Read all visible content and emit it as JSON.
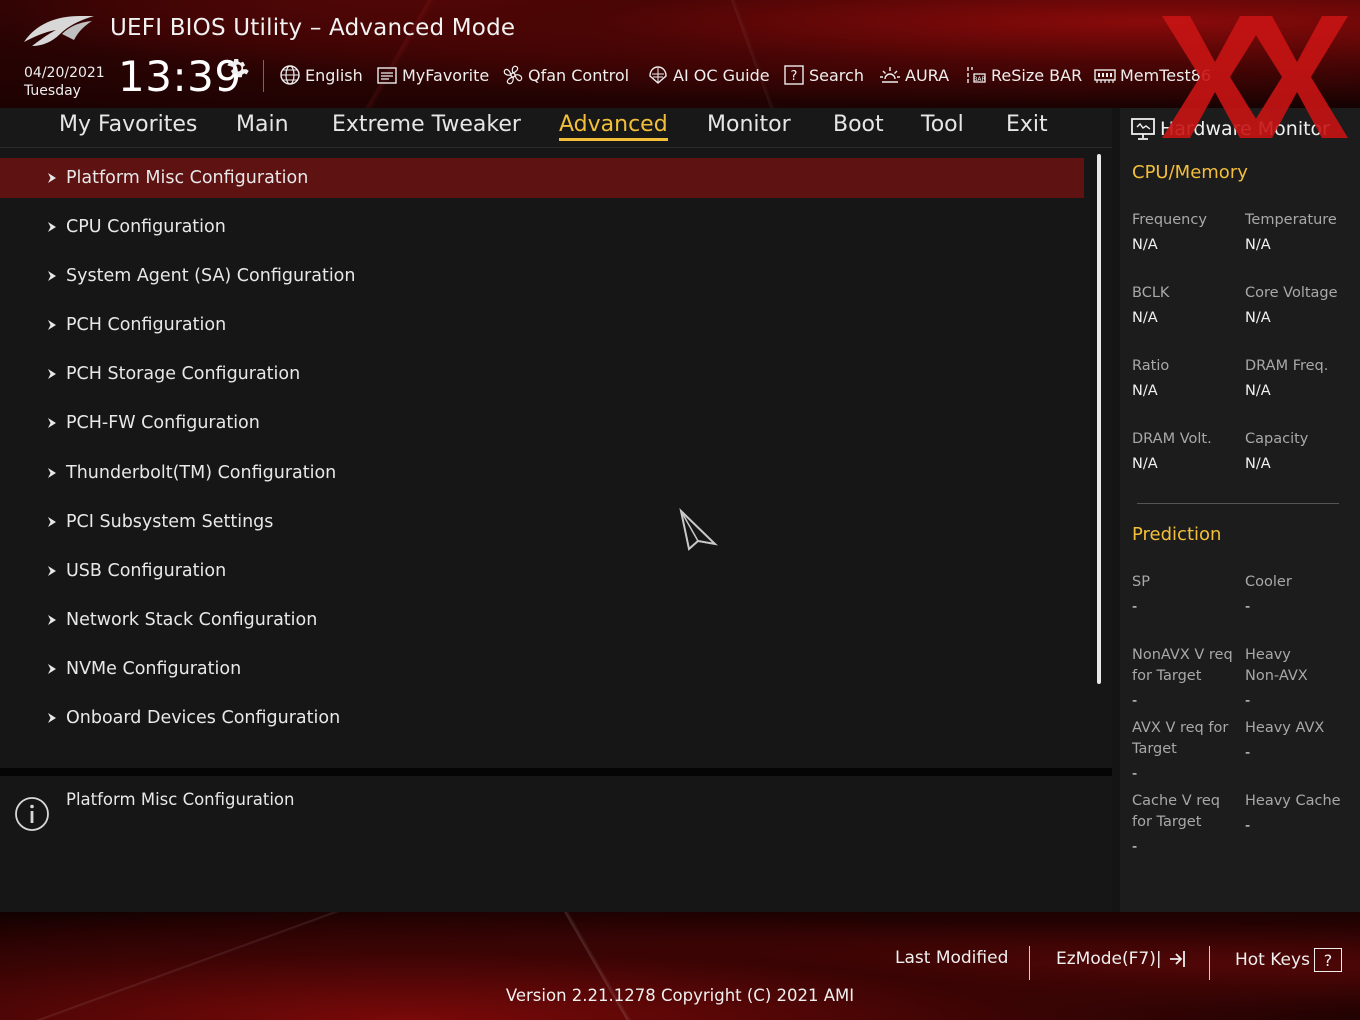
{
  "header": {
    "title": "UEFI BIOS Utility – Advanced Mode",
    "date": "04/20/2021",
    "day": "Tuesday",
    "time": "13:39",
    "tools": [
      {
        "label": "English",
        "icon": "globe-icon"
      },
      {
        "label": "MyFavorite",
        "icon": "favorite-list-icon"
      },
      {
        "label": "Qfan Control",
        "icon": "fan-icon"
      },
      {
        "label": "AI OC Guide",
        "icon": "ai-guide-icon"
      },
      {
        "label": "Search",
        "icon": "search-help-icon"
      },
      {
        "label": "AURA",
        "icon": "aura-icon"
      },
      {
        "label": "ReSize BAR",
        "icon": "resize-bar-icon"
      },
      {
        "label": "MemTest86",
        "icon": "memtest-icon"
      }
    ]
  },
  "tabs": [
    {
      "label": "My Favorites",
      "active": false
    },
    {
      "label": "Main",
      "active": false
    },
    {
      "label": "Extreme Tweaker",
      "active": false
    },
    {
      "label": "Advanced",
      "active": true
    },
    {
      "label": "Monitor",
      "active": false
    },
    {
      "label": "Boot",
      "active": false
    },
    {
      "label": "Tool",
      "active": false
    },
    {
      "label": "Exit",
      "active": false
    }
  ],
  "menu": [
    {
      "label": "Platform Misc Configuration",
      "selected": true
    },
    {
      "label": "CPU Configuration",
      "selected": false
    },
    {
      "label": "System Agent (SA) Configuration",
      "selected": false
    },
    {
      "label": "PCH Configuration",
      "selected": false
    },
    {
      "label": "PCH Storage Configuration",
      "selected": false
    },
    {
      "label": "PCH-FW Configuration",
      "selected": false
    },
    {
      "label": "Thunderbolt(TM) Configuration",
      "selected": false
    },
    {
      "label": "PCI Subsystem Settings",
      "selected": false
    },
    {
      "label": "USB Configuration",
      "selected": false
    },
    {
      "label": "Network Stack Configuration",
      "selected": false
    },
    {
      "label": "NVMe Configuration",
      "selected": false
    },
    {
      "label": "Onboard Devices Configuration",
      "selected": false
    }
  ],
  "help": {
    "text": "Platform Misc Configuration"
  },
  "hw_monitor": {
    "title": "Hardware Monitor",
    "cpu_memory": {
      "title": "CPU/Memory",
      "fields": [
        {
          "label": "Frequency",
          "value": "N/A"
        },
        {
          "label": "Temperature",
          "value": "N/A"
        },
        {
          "label": "BCLK",
          "value": "N/A"
        },
        {
          "label": "Core Voltage",
          "value": "N/A"
        },
        {
          "label": "Ratio",
          "value": "N/A"
        },
        {
          "label": "DRAM Freq.",
          "value": "N/A"
        },
        {
          "label": "DRAM Volt.",
          "value": "N/A"
        },
        {
          "label": "Capacity",
          "value": "N/A"
        }
      ]
    },
    "prediction": {
      "title": "Prediction",
      "fields": [
        {
          "label": "SP",
          "value": "-"
        },
        {
          "label": "Cooler",
          "value": "-"
        },
        {
          "label": "NonAVX V req\nfor Target",
          "value": "-"
        },
        {
          "label": "Heavy\nNon-AVX",
          "value": "-"
        },
        {
          "label": "AVX V req for\nTarget",
          "value": "-"
        },
        {
          "label": "Heavy AVX",
          "value": "-"
        },
        {
          "label": "Cache V req\nfor Target",
          "value": "-"
        },
        {
          "label": "Heavy Cache",
          "value": "-"
        }
      ]
    }
  },
  "footer": {
    "last_modified": "Last Modified",
    "ezmode": "EzMode(F7)|",
    "hotkeys": "Hot Keys",
    "hotkeys_glyph": "?",
    "version": "Version 2.21.1278 Copyright (C) 2021 AMI"
  },
  "colors": {
    "accent": "#f3bf3b",
    "selection": "#5f1212",
    "brand_red": "#c41616"
  }
}
